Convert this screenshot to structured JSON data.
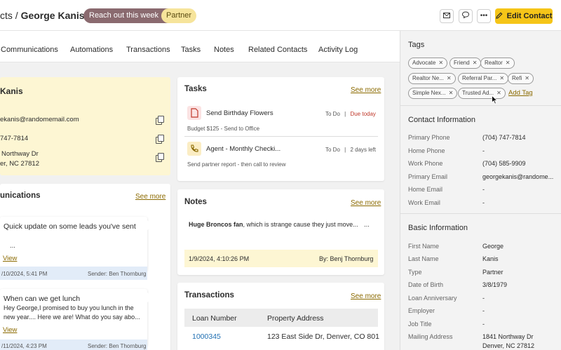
{
  "header": {
    "breadcrumb_prefix": "cts",
    "breadcrumb_sep": "/",
    "contact_name": "George Kanis",
    "stage_label": "Reach out this week",
    "type_badge": "Partner",
    "edit_label": "Edit Contact"
  },
  "tabs": [
    "Communications",
    "Automations",
    "Transactions",
    "Tasks",
    "Notes",
    "Related Contacts",
    "Activity Log"
  ],
  "contact_card": {
    "name": "Kanis",
    "email": "ekanis@randomemail.com",
    "phone": "747-7814",
    "address_line1": "Northway Dr",
    "address_line2": "er, NC 27812"
  },
  "communications": {
    "title": "unications",
    "see_more": "See more",
    "items": [
      {
        "subject": "Quick update on some leads you've sent",
        "body": "...",
        "link": "View",
        "date": "/10/2024, 5:41 PM",
        "sender": "Sender: Ben Thornburg"
      },
      {
        "subject": "When can we get lunch",
        "body1": "Hey George,I promised to buy you lunch in the",
        "body2": "new year....  Here we are! What do you say abo...",
        "link": "View",
        "date": "/11/2024, 4:23 PM",
        "sender": "Sender: Ben Thornburg"
      }
    ]
  },
  "tasks": {
    "title": "Tasks",
    "see_more": "See more",
    "items": [
      {
        "name": "Send Birthday Flowers",
        "status": "To Do",
        "sep": "|",
        "due": "Due today",
        "detail": "Budget $125 - Send to Office"
      },
      {
        "name": "Agent - Monthly Checki...",
        "status": "To Do",
        "sep": "|",
        "due": "2 days left",
        "detail": "Send partner report - then call to review"
      }
    ]
  },
  "notes": {
    "title": "Notes",
    "see_more": "See more",
    "bold": "Huge Broncos fan",
    "text": ", which is strange cause they just move...",
    "ellipsis": "...",
    "date": "1/9/2024, 4:10:26 PM",
    "by": "By: Benj Thornburg"
  },
  "transactions": {
    "title": "Transactions",
    "see_more": "See more",
    "columns": [
      "Loan Number",
      "Property Address"
    ],
    "rows": [
      {
        "loan": "1000345",
        "address": "123 East Side Dr, Denver, CO 801"
      }
    ]
  },
  "tags": {
    "title": "Tags",
    "items": [
      "Advocate",
      "Friend",
      "Realtor",
      "Realtor Ne...",
      "Referral Par...",
      "Refi",
      "Simple Nex...",
      "Trusted Ad..."
    ],
    "add_label": "Add Tag"
  },
  "contact_info": {
    "title": "Contact Information",
    "rows": [
      {
        "label": "Primary Phone",
        "value": "(704) 747-7814"
      },
      {
        "label": "Home Phone",
        "value": "-"
      },
      {
        "label": "Work Phone",
        "value": "(704) 585-9909"
      },
      {
        "label": "Primary Email",
        "value": "georgekanis@randome..."
      },
      {
        "label": "Home Email",
        "value": "-"
      },
      {
        "label": "Work Email",
        "value": "-"
      }
    ]
  },
  "basic_info": {
    "title": "Basic Information",
    "rows": [
      {
        "label": "First Name",
        "value": "George"
      },
      {
        "label": "Last Name",
        "value": "Kanis"
      },
      {
        "label": "Type",
        "value": "Partner"
      },
      {
        "label": "Date of Birth",
        "value": "3/8/1979"
      },
      {
        "label": "Loan Anniversary",
        "value": "-"
      },
      {
        "label": "Employer",
        "value": "-"
      },
      {
        "label": "Job Title",
        "value": "-"
      },
      {
        "label": "Mailing Address",
        "value": "1841 Northway Dr",
        "value2": "Denver, NC 27812"
      }
    ]
  },
  "colors": {
    "accent": "#f5c518",
    "stage": "#8a6a6f",
    "badge": "#f6e49b",
    "link": "#1f6fb2",
    "see_more": "#8b6a00"
  }
}
